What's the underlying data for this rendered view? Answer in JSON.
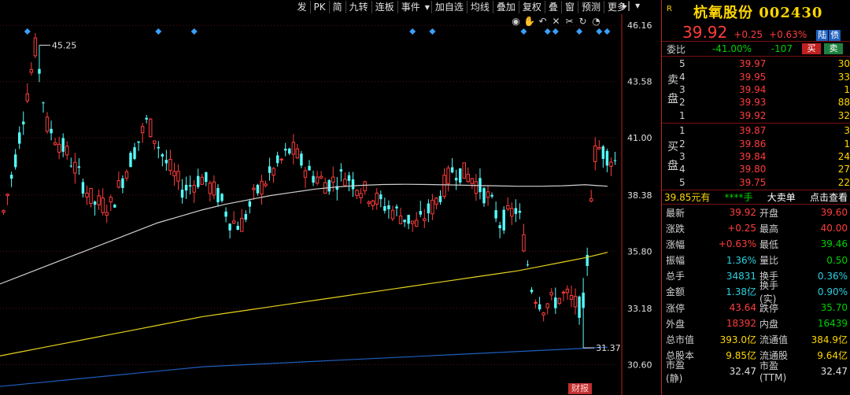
{
  "toolbar": {
    "items": [
      "发",
      "PK",
      "简",
      "九转",
      "连板",
      "事件",
      "加自选",
      "均线",
      "叠加",
      "画",
      "复权",
      "叠",
      "窗",
      "预测",
      "更多"
    ],
    "tool_icons": [
      "eye-icon",
      "hand-icon",
      "undo-icon",
      "cross-icon",
      "cut-icon",
      "refresh-icon",
      "clock-icon"
    ]
  },
  "chart_data": {
    "type": "candlestick",
    "ylim": [
      30.0,
      46.6
    ],
    "y_ticks": [
      {
        "value": 46.16,
        "label": "46.16"
      },
      {
        "value": 43.58,
        "label": "43.58"
      },
      {
        "value": 41.0,
        "label": "41.00"
      },
      {
        "value": 38.38,
        "label": "38.38"
      },
      {
        "value": 35.8,
        "label": "35.80"
      },
      {
        "value": 33.18,
        "label": "33.18"
      },
      {
        "value": 30.6,
        "label": "30.60"
      }
    ],
    "annotations": [
      {
        "label": "45.25",
        "value": 45.25,
        "bar": 9
      },
      {
        "label": "31.37",
        "value": 31.37,
        "bar": 146
      }
    ],
    "ma_series": [
      {
        "name": "ma-white",
        "color": "#cfcfcf",
        "values": [
          34.3,
          34.7,
          35.1,
          35.5,
          35.9,
          36.3,
          36.7,
          37.1,
          37.4,
          37.7,
          37.95,
          38.15,
          38.35,
          38.5,
          38.65,
          38.75,
          38.82,
          38.86,
          38.87,
          38.86,
          38.84,
          38.82,
          38.8,
          38.78,
          38.78,
          38.8,
          38.85,
          38.78
        ]
      },
      {
        "name": "ma-yellow",
        "color": "#e6d21e",
        "values": [
          31.0,
          31.2,
          31.4,
          31.6,
          31.8,
          32.0,
          32.2,
          32.4,
          32.6,
          32.8,
          32.95,
          33.1,
          33.25,
          33.4,
          33.55,
          33.7,
          33.85,
          34.0,
          34.15,
          34.3,
          34.45,
          34.6,
          34.75,
          34.9,
          35.1,
          35.3,
          35.5,
          35.75
        ]
      },
      {
        "name": "ma-blue",
        "color": "#1e5fbf",
        "values": [
          29.6,
          29.7,
          29.8,
          29.9,
          30.0,
          30.1,
          30.2,
          30.3,
          30.4,
          30.5,
          30.55,
          30.6,
          30.65,
          30.7,
          30.75,
          30.8,
          30.85,
          30.9,
          30.95,
          31.0,
          31.05,
          31.1,
          31.15,
          31.2,
          31.25,
          31.3,
          31.35,
          31.4
        ]
      }
    ],
    "up_color": "#ff3c3c",
    "down_color": "#54fcfc",
    "event_markers_bars": [
      6,
      39,
      48,
      103,
      108,
      131,
      137,
      139,
      145,
      150,
      152
    ],
    "event_tag": "财报"
  },
  "quote": {
    "r_mark": "R",
    "name": "杭氧股份 002430",
    "price": "39.92",
    "change": "+0.25",
    "change_pct": "+0.63%",
    "badges": [
      "陆",
      "债"
    ]
  },
  "weibi": {
    "label": "委比",
    "ratio": "-41.00%",
    "diff": "-107",
    "buy": "买",
    "sell": "卖"
  },
  "sell_side": {
    "label": "卖盘",
    "rows": [
      {
        "lvl": "5",
        "price": "39.97",
        "vol": "30"
      },
      {
        "lvl": "4",
        "price": "39.95",
        "vol": "33"
      },
      {
        "lvl": "3",
        "price": "39.94",
        "vol": "1"
      },
      {
        "lvl": "2",
        "price": "39.93",
        "vol": "88"
      },
      {
        "lvl": "1",
        "price": "39.92",
        "vol": "32"
      }
    ]
  },
  "buy_side": {
    "label": "买盘",
    "rows": [
      {
        "lvl": "1",
        "price": "39.87",
        "vol": "3"
      },
      {
        "lvl": "2",
        "price": "39.86",
        "vol": "1"
      },
      {
        "lvl": "3",
        "price": "39.84",
        "vol": "24"
      },
      {
        "lvl": "4",
        "price": "39.80",
        "vol": "27"
      },
      {
        "lvl": "5",
        "price": "39.75",
        "vol": "22"
      }
    ]
  },
  "big_order": {
    "price": "39.85元有",
    "vol": "****手",
    "label": "大卖单",
    "link": "点击查看"
  },
  "stats": [
    {
      "k1": "最新",
      "v1": "39.92",
      "c1": "red",
      "k2": "开盘",
      "v2": "39.60",
      "c2": "red"
    },
    {
      "k1": "涨跌",
      "v1": "+0.25",
      "c1": "red",
      "k2": "最高",
      "v2": "40.00",
      "c2": "red"
    },
    {
      "k1": "涨幅",
      "v1": "+0.63%",
      "c1": "red",
      "k2": "最低",
      "v2": "39.46",
      "c2": "green"
    },
    {
      "k1": "振幅",
      "v1": "1.36%",
      "c1": "cyan",
      "k2": "量比",
      "v2": "0.50",
      "c2": "green"
    },
    {
      "k1": "总手",
      "v1": "34831",
      "c1": "cyan",
      "k2": "换手",
      "v2": "0.36%",
      "c2": "cyan"
    },
    {
      "k1": "金额",
      "v1": "1.38亿",
      "c1": "cyan",
      "k2": "换手(实)",
      "v2": "0.90%",
      "c2": "cyan"
    },
    {
      "k1": "涨停",
      "v1": "43.64",
      "c1": "red",
      "k2": "跌停",
      "v2": "35.70",
      "c2": "green"
    },
    {
      "k1": "外盘",
      "v1": "18392",
      "c1": "red",
      "k2": "内盘",
      "v2": "16439",
      "c2": "green"
    },
    {
      "k1": "总市值",
      "v1": "393.0亿",
      "c1": "yellow",
      "k2": "流通值",
      "v2": "384.9亿",
      "c2": "yellow"
    },
    {
      "k1": "总股本",
      "v1": "9.85亿",
      "c1": "yellow",
      "k2": "流通股",
      "v2": "9.64亿",
      "c2": "yellow"
    },
    {
      "k1": "市盈(静)",
      "v1": "32.47",
      "c1": "white",
      "k2": "市盈(TTM)",
      "v2": "32.47",
      "c2": "white"
    }
  ]
}
